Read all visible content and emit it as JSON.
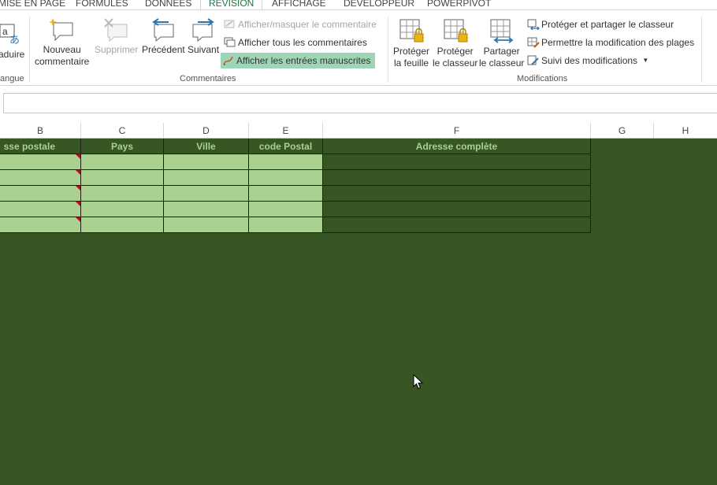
{
  "tabs": [
    "MISE EN PAGE",
    "FORMULES",
    "DONNÉES",
    "RÉVISION",
    "AFFICHAGE",
    "DÉVELOPPEUR",
    "POWERPIVOT"
  ],
  "active_tab": "RÉVISION",
  "ribbon": {
    "langue_group": {
      "traduire_label": "aduire",
      "label": "angue"
    },
    "commentaires_group": {
      "label": "Commentaires",
      "nouveau_line1": "Nouveau",
      "nouveau_line2": "commentaire",
      "supprimer": "Supprimer",
      "precedent": "Précédent",
      "suivant": "Suivant",
      "afficher_masquer": "Afficher/masquer le commentaire",
      "afficher_tous": "Afficher tous les commentaires",
      "afficher_manuscrites": "Afficher les entrées manuscrites"
    },
    "modifications_group": {
      "label": "Modifications",
      "proteger_feuille_line1": "Protéger",
      "proteger_feuille_line2": "la feuille",
      "proteger_classeur_line1": "Protéger",
      "proteger_classeur_line2": "le classeur",
      "partager_classeur_line1": "Partager",
      "partager_classeur_line2": "le classeur",
      "proteger_partager": "Protéger et partager le classeur",
      "permettre_modification": "Permettre la modification des plages",
      "suivi_modifications": "Suivi des modifications"
    }
  },
  "columns": [
    "B",
    "C",
    "D",
    "E",
    "F",
    "G",
    "H"
  ],
  "table": {
    "headers": [
      "sse postale",
      "Pays",
      "Ville",
      "code Postal",
      "Adresse complète"
    ],
    "row_count": 5
  },
  "colors": {
    "sheet_bg": "#375623",
    "light_cell": "#a9d08e",
    "header_text": "#a9d08e",
    "highlight": "#9fd5b7",
    "accent": "#217346",
    "comment_mark": "#d0021b"
  }
}
